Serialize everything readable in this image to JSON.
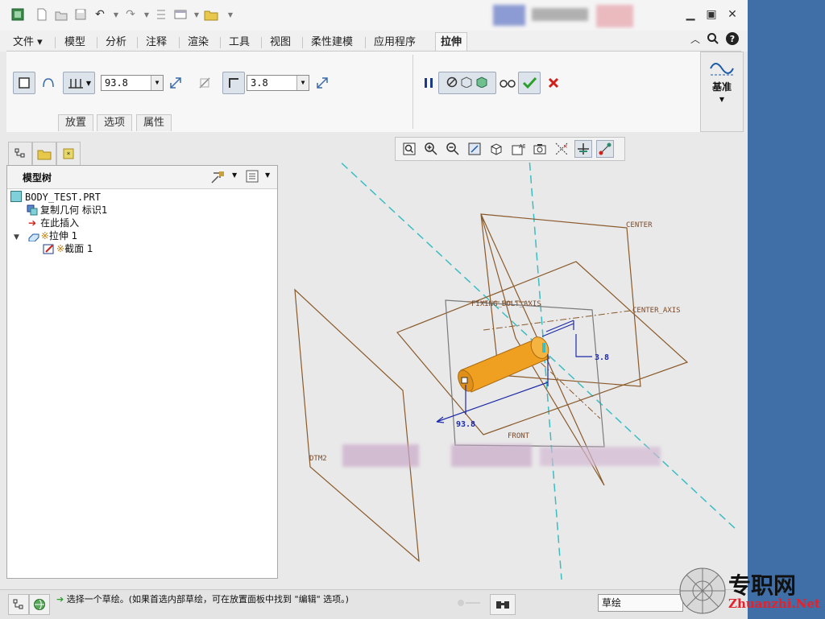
{
  "window": {
    "title_blurred": ""
  },
  "quick_access": {
    "icons": [
      "app-icon",
      "new-icon",
      "open-icon",
      "save-icon",
      "undo-icon",
      "redo-icon",
      "regenerate-icon",
      "windows-icon",
      "folder-icon",
      "customize-icon"
    ]
  },
  "tabs": [
    "文件",
    "模型",
    "分析",
    "注释",
    "渲染",
    "工具",
    "视图",
    "柔性建模",
    "应用程序",
    "拉伸"
  ],
  "ribbon": {
    "depth_value": "93.8",
    "thickness_value": "3.8",
    "subtabs": [
      "放置",
      "选项",
      "属性"
    ],
    "right_group_label": "基准"
  },
  "model_tree": {
    "title": "模型树",
    "items": [
      {
        "label": "BODY_TEST.PRT",
        "level": 0
      },
      {
        "label": "复制几何 标识1",
        "level": 1
      },
      {
        "label": "在此插入",
        "level": 1
      },
      {
        "label": "拉伸 1",
        "level": 0,
        "expanded": true,
        "prefix": "※"
      },
      {
        "label": "截面 1",
        "level": 2,
        "prefix": "※"
      }
    ]
  },
  "viewport": {
    "labels": {
      "center": "CENTER",
      "center_axis": "CENTER_AXIS",
      "fixing_bolt_axis": "FIXING_BOLT_AXIS",
      "front": "FRONT",
      "dtm2": "DTM2"
    },
    "dimensions": {
      "depth": "93.8",
      "thickness": "3.8"
    }
  },
  "status": {
    "message": "选择一个草绘。(如果首选内部草绘，可在放置面板中找到 \"编辑\" 选项。)",
    "filter": "草绘"
  },
  "watermark": {
    "cn": "专职网",
    "en": "Zhuanzhi.Net"
  },
  "colors": {
    "accent_blue": "#3f6fa6",
    "feature_orange": "#f0a020",
    "datum_brown": "#8a5a2b",
    "dim_blue": "#1c2aa8",
    "axis_cyan": "#3bbdc2",
    "ok_green": "#2aa02a",
    "cancel_red": "#d0201a"
  }
}
